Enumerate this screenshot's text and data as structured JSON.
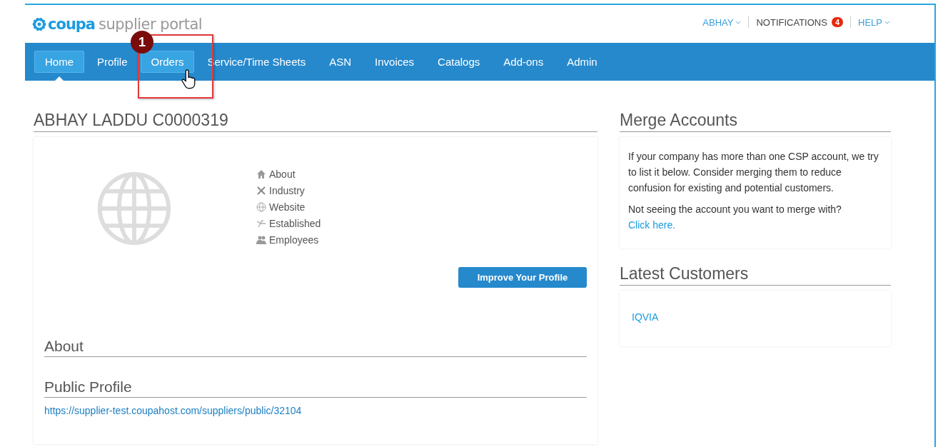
{
  "header": {
    "logo_brand": "coupa",
    "logo_product": "supplier portal",
    "user_menu": "ABHAY",
    "notifications": {
      "label": "NOTIFICATIONS",
      "count": "4"
    },
    "help_menu": "HELP"
  },
  "nav": [
    {
      "label": "Home",
      "selected": true,
      "highlighted": true
    },
    {
      "label": "Profile",
      "selected": false,
      "highlighted": false
    },
    {
      "label": "Orders",
      "selected": false,
      "highlighted": true
    },
    {
      "label": "Service/Time Sheets",
      "selected": false,
      "highlighted": false
    },
    {
      "label": "ASN",
      "selected": false,
      "highlighted": false
    },
    {
      "label": "Invoices",
      "selected": false,
      "highlighted": false
    },
    {
      "label": "Catalogs",
      "selected": false,
      "highlighted": false
    },
    {
      "label": "Add-ons",
      "selected": false,
      "highlighted": false
    },
    {
      "label": "Admin",
      "selected": false,
      "highlighted": false
    }
  ],
  "annotation": {
    "step": "1"
  },
  "profile": {
    "title": "ABHAY LADDU C0000319",
    "facts": [
      {
        "kind": "home",
        "label": "About"
      },
      {
        "kind": "tools",
        "label": "Industry"
      },
      {
        "kind": "globe",
        "label": "Website"
      },
      {
        "kind": "branch",
        "label": "Established"
      },
      {
        "kind": "people",
        "label": "Employees"
      }
    ],
    "button": "Improve Your Profile",
    "about_heading": "About",
    "public_heading": "Public Profile",
    "public_link": "https://supplier-test.coupahost.com/suppliers/public/32104"
  },
  "merge": {
    "title": "Merge Accounts",
    "text": "If your company has more than one CSP account, we try to list it below. Consider merging them to reduce confusion for existing and potential customers.",
    "prompt": "Not seeing the account you want to merge with?",
    "link": "Click here."
  },
  "customers": {
    "title": "Latest Customers",
    "items": [
      "IQVIA"
    ]
  }
}
